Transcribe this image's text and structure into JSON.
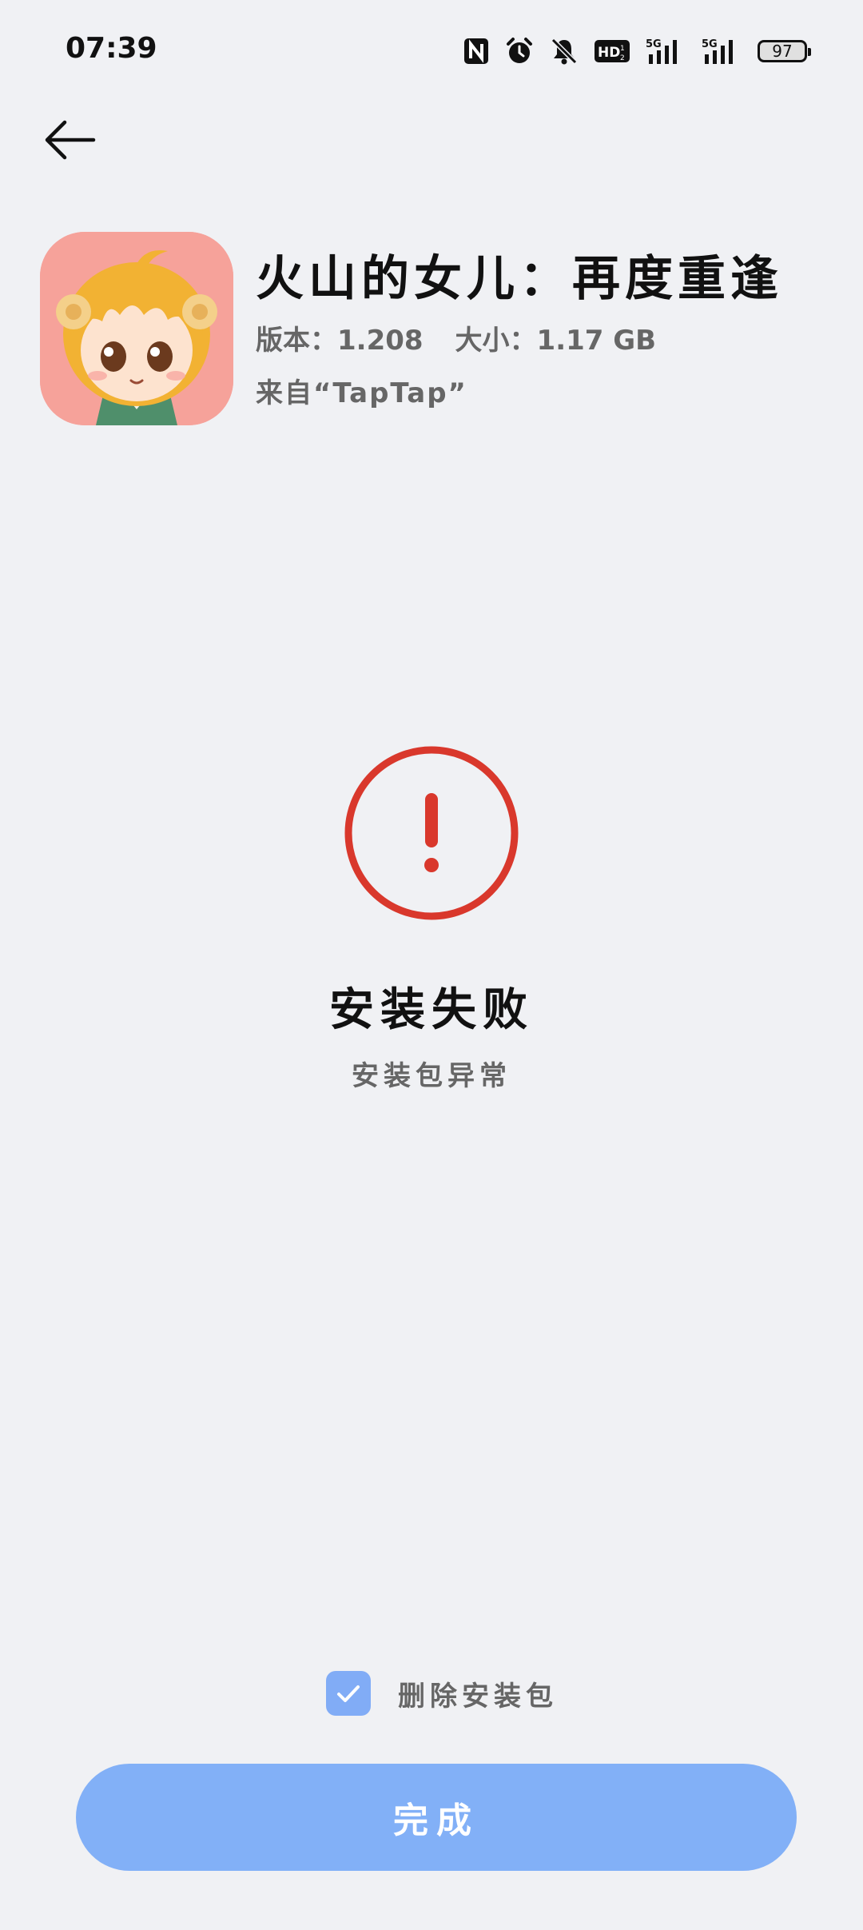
{
  "status_bar": {
    "time": "07:39",
    "battery": "97",
    "icons": [
      "nfc-icon",
      "alarm-icon",
      "silent-bell-icon",
      "hd-icon",
      "5g-signal-icon",
      "5g-signal-icon",
      "battery-icon"
    ]
  },
  "navigation": {
    "back_icon": "back-arrow-icon"
  },
  "app": {
    "name": "火山的女儿：再度重逢",
    "version": "版本：1.208",
    "size": "大小：1.17 GB",
    "source": "来自“TapTap”",
    "icon": "anime-girl-app-icon"
  },
  "result": {
    "icon": "error-exclamation-icon",
    "title": "安装失败",
    "subtitle": "安装包异常",
    "accent_color": "#d9382c"
  },
  "options": {
    "delete_package_label": "删除安装包",
    "delete_package_checked": true
  },
  "actions": {
    "done_label": "完成",
    "button_color": "#82b0f7"
  }
}
